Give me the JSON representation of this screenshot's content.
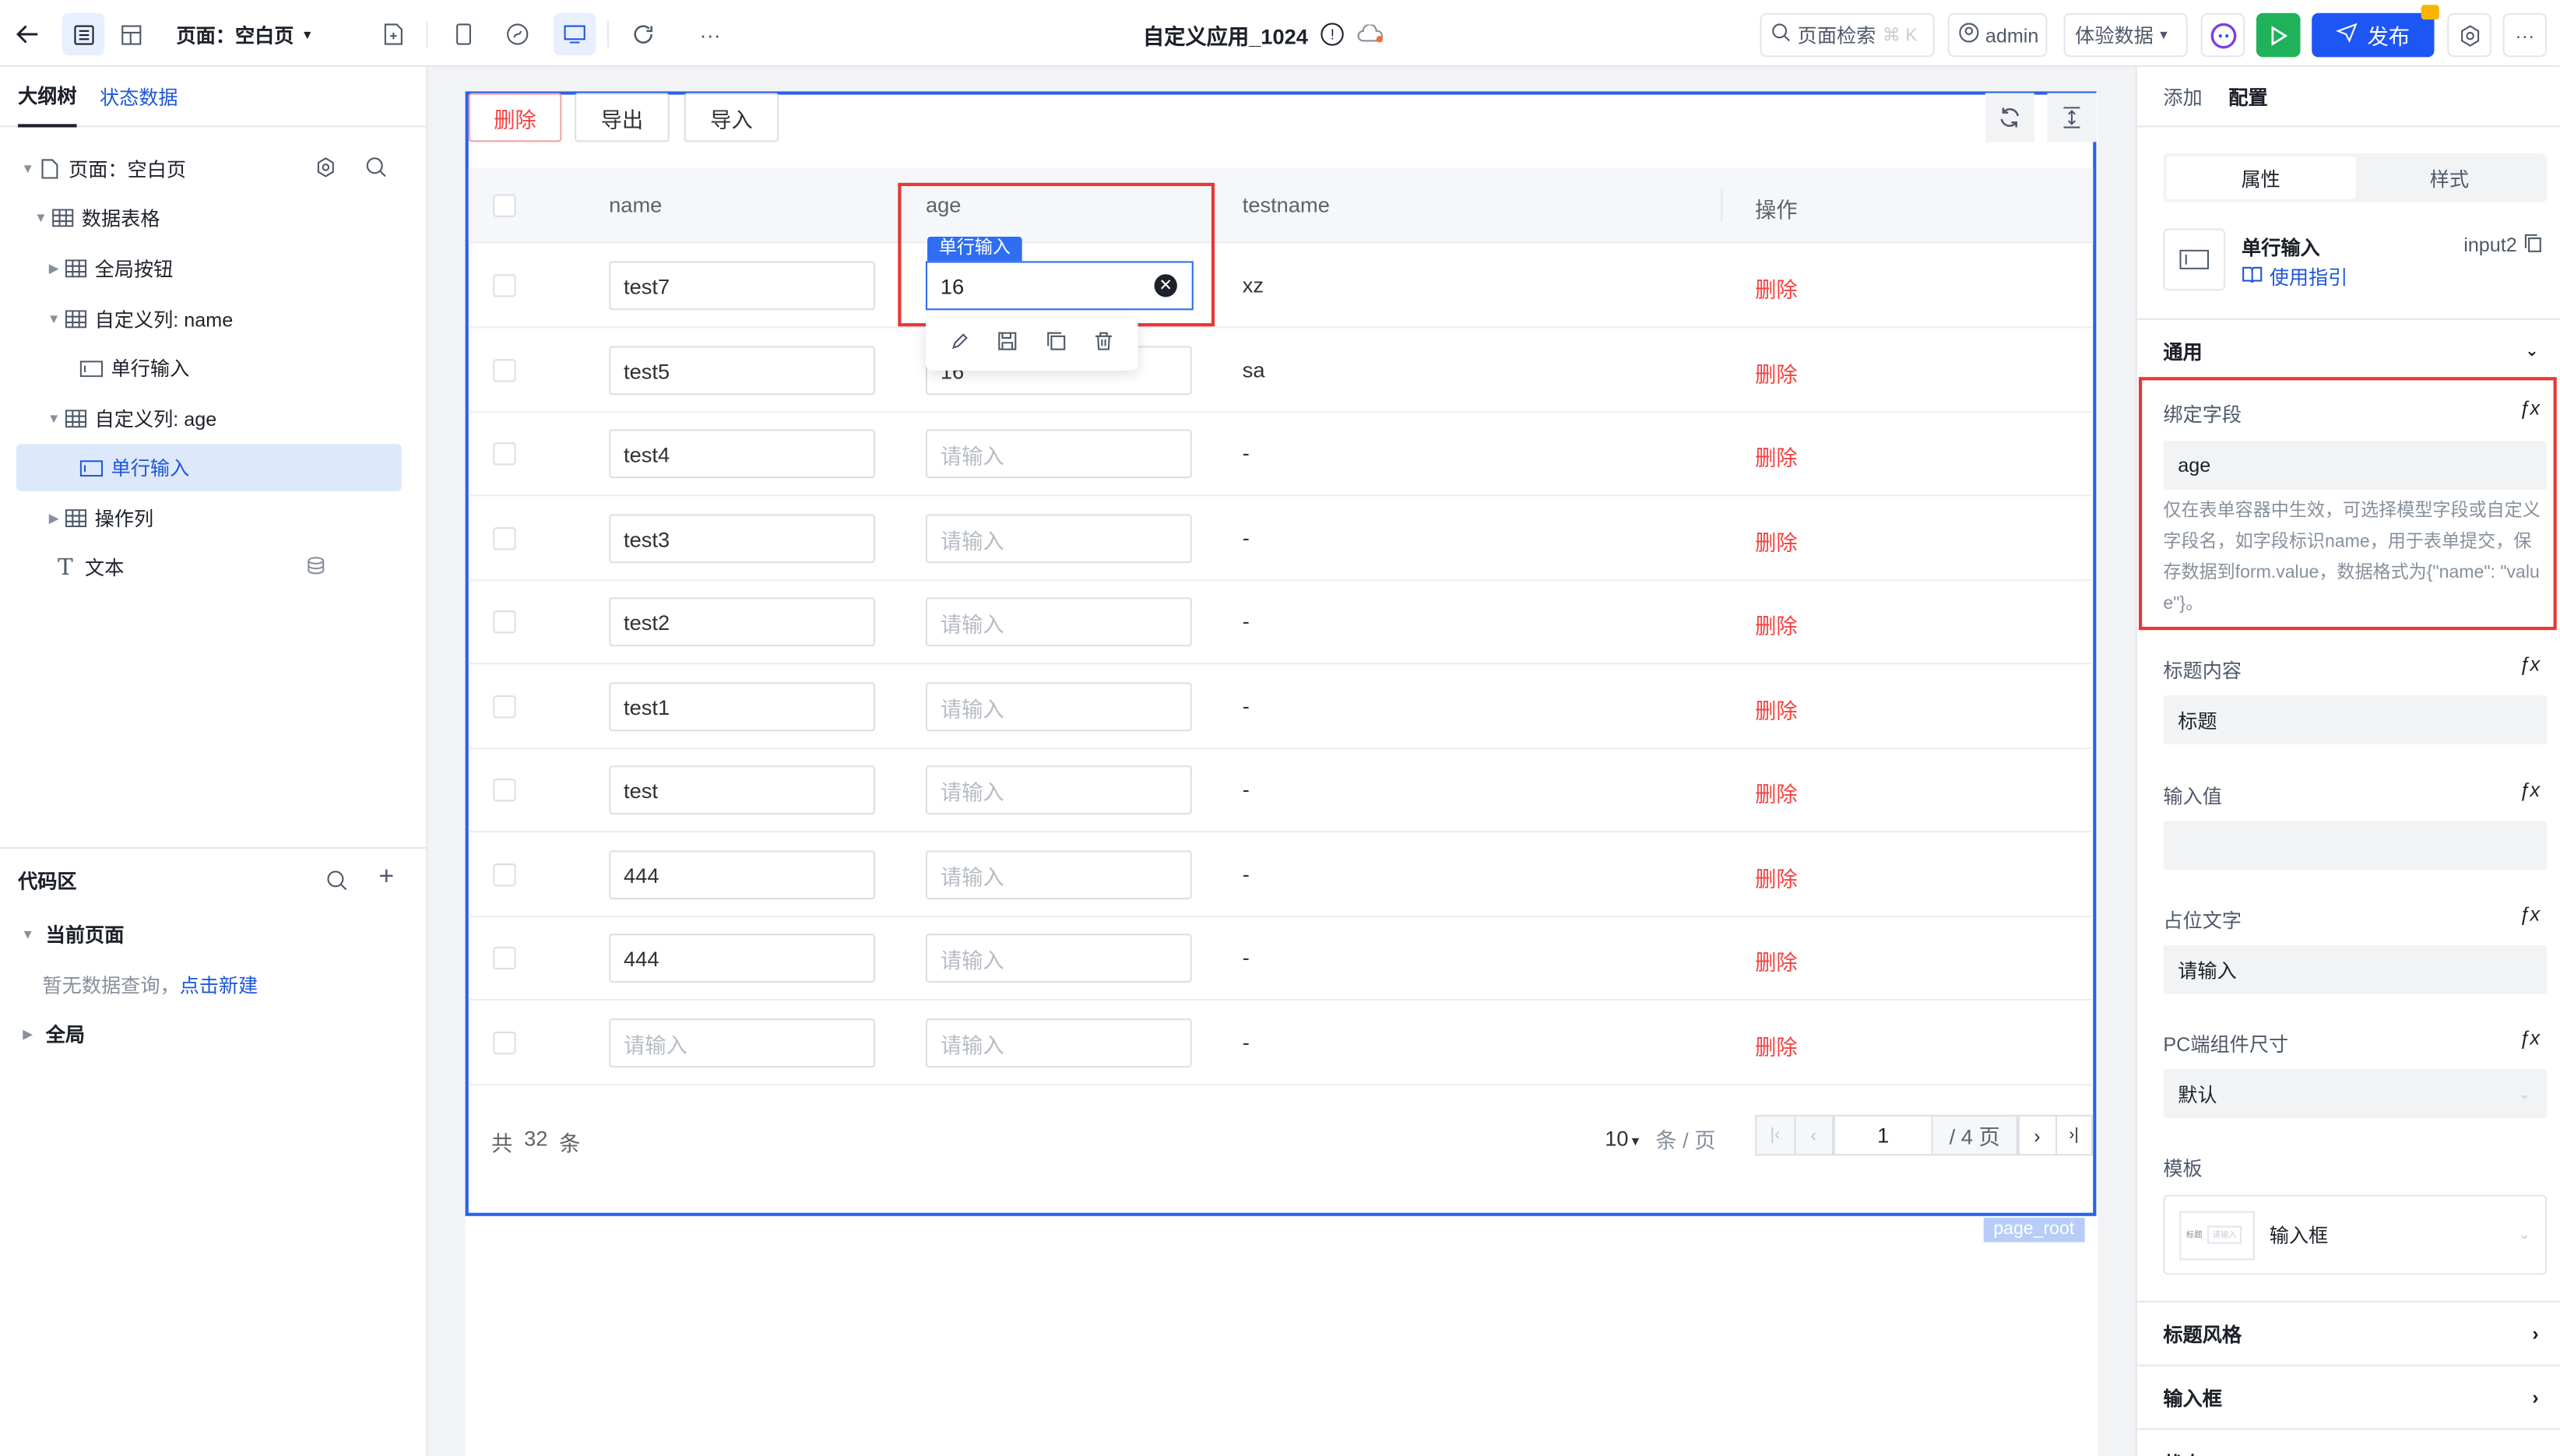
{
  "topbar": {
    "page_label": "页面：空白页",
    "app_title": "自定义应用_1024",
    "search_label": "页面检索",
    "search_shortcut": "⌘ K",
    "user": "admin",
    "data_mode": "体验数据",
    "publish": "发布"
  },
  "left": {
    "tabs": [
      "大纲树",
      "状态数据"
    ],
    "tree": [
      {
        "label": "页面：空白页"
      },
      {
        "label": "数据表格"
      },
      {
        "label": "全局按钮"
      },
      {
        "label": "自定义列: name"
      },
      {
        "label": "单行输入"
      },
      {
        "label": "自定义列: age"
      },
      {
        "label": "单行输入"
      },
      {
        "label": "操作列"
      },
      {
        "label": "文本"
      }
    ],
    "code": {
      "title": "代码区",
      "current_page": "当前页面",
      "empty_text": "暂无数据查询，",
      "create_link": "点击新建",
      "global": "全局"
    }
  },
  "canvas": {
    "toolbar": {
      "delete": "删除",
      "export": "导出",
      "import": "导入"
    },
    "columns": [
      "name",
      "age",
      "testname",
      "操作"
    ],
    "rows": [
      {
        "name": "test7",
        "age": "16",
        "testname": "xz",
        "action": "删除"
      },
      {
        "name": "test5",
        "age": "16",
        "testname": "sa",
        "action": "删除"
      },
      {
        "name": "test4",
        "age": "",
        "testname": "-",
        "action": "删除"
      },
      {
        "name": "test3",
        "age": "",
        "testname": "-",
        "action": "删除"
      },
      {
        "name": "test2",
        "age": "",
        "testname": "-",
        "action": "删除"
      },
      {
        "name": "test1",
        "age": "",
        "testname": "-",
        "action": "删除"
      },
      {
        "name": "test",
        "age": "",
        "testname": "-",
        "action": "删除"
      },
      {
        "name": "444",
        "age": "",
        "testname": "-",
        "action": "删除"
      },
      {
        "name": "444",
        "age": "",
        "testname": "-",
        "action": "删除"
      },
      {
        "name": "",
        "age": "",
        "testname": "-",
        "action": "删除"
      }
    ],
    "placeholder": "请输入",
    "selected_tag": "单行输入",
    "active_value": "16",
    "pagination": {
      "total_prefix": "共",
      "total": "32",
      "total_suffix": "条",
      "page_size": "10",
      "per_page_unit": "条 / 页",
      "current_page": "1",
      "total_pages_label": "/ 4 页"
    },
    "root_tag": "page_root"
  },
  "right": {
    "tabs": [
      "添加",
      "配置"
    ],
    "segments": [
      "属性",
      "样式"
    ],
    "component": {
      "name": "单行输入",
      "id": "input2",
      "guide": "使用指引"
    },
    "section_general": "通用",
    "fields": {
      "bind_label": "绑定字段",
      "bind_value": "age",
      "bind_help": "仅在表单容器中生效，可选择模型字段或自定义字段名，如字段标识name，用于表单提交，保存数据到form.value，数据格式为{\"name\": \"value\"}。",
      "title_label": "标题内容",
      "title_value": "标题",
      "value_label": "输入值",
      "value_value": "",
      "placeholder_label": "占位文字",
      "placeholder_value": "请输入",
      "size_label": "PC端组件尺寸",
      "size_value": "默认",
      "template_label": "模板",
      "template_value": "输入框",
      "template_thumb_title": "标题",
      "template_thumb_input": "请输入",
      "fx": "ƒx"
    },
    "sections": [
      "标题风格",
      "输入框",
      "状态"
    ]
  },
  "colors": {
    "brand": "#1e56f5",
    "danger": "#f53f3f",
    "highlight": "#e53935",
    "run": "#1fb25a"
  }
}
